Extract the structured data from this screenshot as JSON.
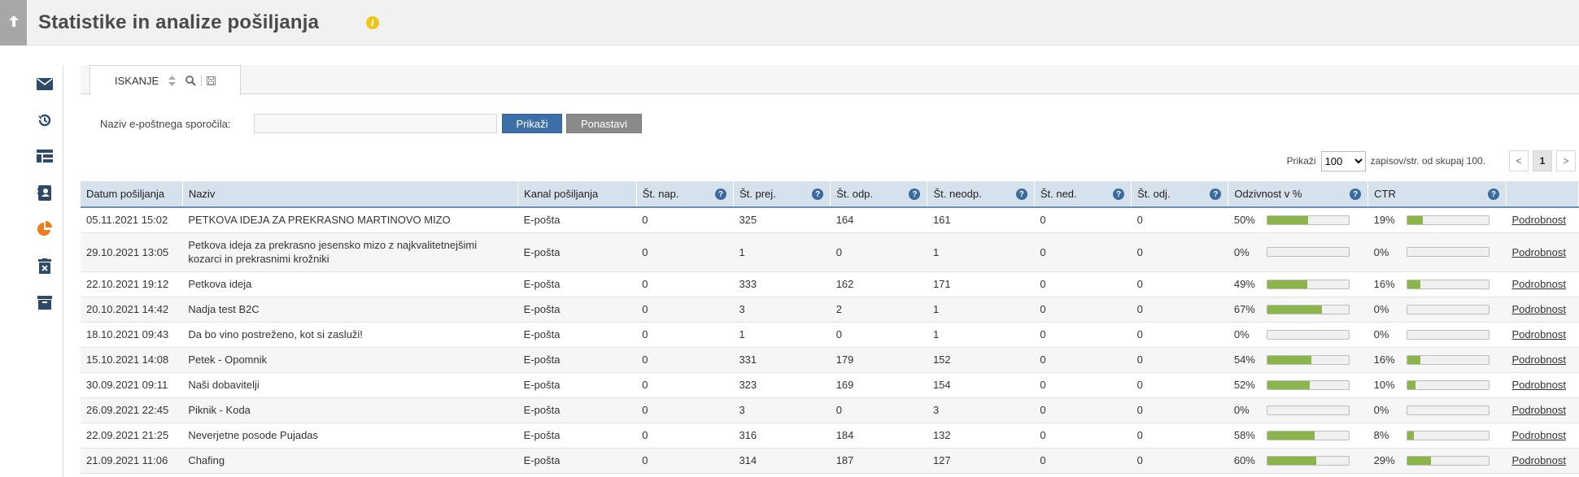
{
  "header": {
    "title": "Statistike in analize pošiljanja"
  },
  "icons": {
    "back": "arrow-up-icon",
    "info": "info-icon",
    "sidebar": [
      "envelope-icon",
      "history-icon",
      "dashboard-icon",
      "contacts-icon",
      "pie-chart-icon",
      "trash-icon",
      "archive-icon"
    ]
  },
  "colors": {
    "accent": "#3f6fa8",
    "active_sidebar": "#f07b1d",
    "bar_fill": "#8bb54a",
    "info": "#f0c419"
  },
  "tab": {
    "label": "ISKANJE"
  },
  "filter": {
    "label": "Naziv e-poštnega sporočila:",
    "value": "",
    "show_label": "Prikaži",
    "reset_label": "Ponastavi"
  },
  "pager": {
    "prefix": "Prikaži",
    "page_size": "100",
    "suffix": "zapisov/str. od skupaj 100.",
    "prev": "<",
    "current": "1",
    "next": ">"
  },
  "table": {
    "headers": [
      "Datum pošiljanja",
      "Naziv",
      "Kanal pošiljanja",
      "Št. nap.",
      "Št. prej.",
      "Št. odp.",
      "Št. neodp.",
      "Št. ned.",
      "Št. odj.",
      "Odzivnost v %",
      "CTR",
      ""
    ],
    "help_glyph": "?",
    "detail_label": "Podrobnost",
    "rows": [
      {
        "date": "05.11.2021 15:02",
        "name": "PETKOVA IDEJA ZA PREKRASNO MARTINOVO MIZO",
        "channel": "E-pošta",
        "nap": "0",
        "prej": "325",
        "odp": "164",
        "neodp": "161",
        "ned": "0",
        "odj": "0",
        "resp": "50%",
        "resp_pct": 50,
        "ctr": "19%",
        "ctr_pct": 19
      },
      {
        "date": "29.10.2021 13:05",
        "name": "Petkova ideja za prekrasno jesensko mizo z najkvalitetnejšimi kozarci in prekrasnimi krožniki",
        "channel": "E-pošta",
        "nap": "0",
        "prej": "1",
        "odp": "0",
        "neodp": "1",
        "ned": "0",
        "odj": "0",
        "resp": "0%",
        "resp_pct": 0,
        "ctr": "0%",
        "ctr_pct": 0
      },
      {
        "date": "22.10.2021 19:12",
        "name": "Petkova ideja",
        "channel": "E-pošta",
        "nap": "0",
        "prej": "333",
        "odp": "162",
        "neodp": "171",
        "ned": "0",
        "odj": "0",
        "resp": "49%",
        "resp_pct": 49,
        "ctr": "16%",
        "ctr_pct": 16
      },
      {
        "date": "20.10.2021 14:42",
        "name": "Nadja test B2C",
        "channel": "E-pošta",
        "nap": "0",
        "prej": "3",
        "odp": "2",
        "neodp": "1",
        "ned": "0",
        "odj": "0",
        "resp": "67%",
        "resp_pct": 67,
        "ctr": "0%",
        "ctr_pct": 0
      },
      {
        "date": "18.10.2021 09:43",
        "name": "Da bo vino postreženo, kot si zasluži!",
        "channel": "E-pošta",
        "nap": "0",
        "prej": "1",
        "odp": "0",
        "neodp": "1",
        "ned": "0",
        "odj": "0",
        "resp": "0%",
        "resp_pct": 0,
        "ctr": "0%",
        "ctr_pct": 0
      },
      {
        "date": "15.10.2021 14:08",
        "name": "Petek - Opomnik",
        "channel": "E-pošta",
        "nap": "0",
        "prej": "331",
        "odp": "179",
        "neodp": "152",
        "ned": "0",
        "odj": "0",
        "resp": "54%",
        "resp_pct": 54,
        "ctr": "16%",
        "ctr_pct": 16
      },
      {
        "date": "30.09.2021 09:11",
        "name": "Naši dobavitelji",
        "channel": "E-pošta",
        "nap": "0",
        "prej": "323",
        "odp": "169",
        "neodp": "154",
        "ned": "0",
        "odj": "0",
        "resp": "52%",
        "resp_pct": 52,
        "ctr": "10%",
        "ctr_pct": 10
      },
      {
        "date": "26.09.2021 22:45",
        "name": "Piknik - Koda",
        "channel": "E-pošta",
        "nap": "0",
        "prej": "3",
        "odp": "0",
        "neodp": "3",
        "ned": "0",
        "odj": "0",
        "resp": "0%",
        "resp_pct": 0,
        "ctr": "0%",
        "ctr_pct": 0
      },
      {
        "date": "22.09.2021 21:25",
        "name": "Neverjetne posode Pujadas",
        "channel": "E-pošta",
        "nap": "0",
        "prej": "316",
        "odp": "184",
        "neodp": "132",
        "ned": "0",
        "odj": "0",
        "resp": "58%",
        "resp_pct": 58,
        "ctr": "8%",
        "ctr_pct": 8
      },
      {
        "date": "21.09.2021 11:06",
        "name": "Chafing",
        "channel": "E-pošta",
        "nap": "0",
        "prej": "314",
        "odp": "187",
        "neodp": "127",
        "ned": "0",
        "odj": "0",
        "resp": "60%",
        "resp_pct": 60,
        "ctr": "29%",
        "ctr_pct": 29
      }
    ]
  }
}
